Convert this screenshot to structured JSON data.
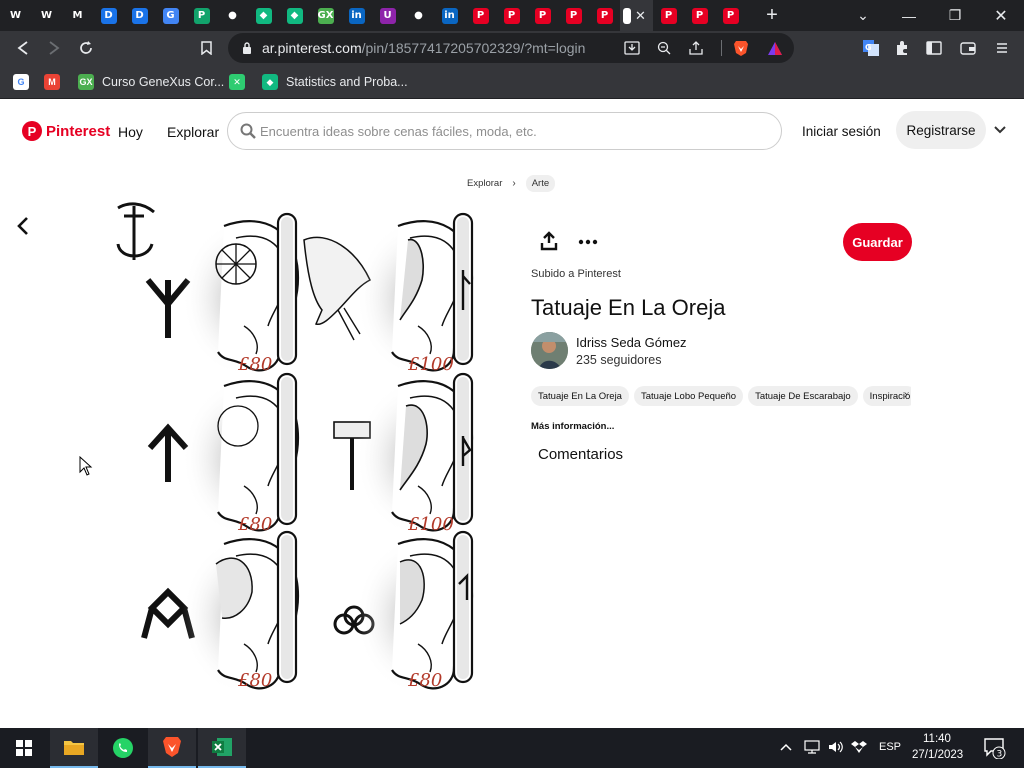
{
  "browser": {
    "tabs": [
      {
        "icon": "wix-icon",
        "label": "",
        "color": "#202124",
        "text": "W"
      },
      {
        "icon": "webflow-icon",
        "label": "",
        "color": "#202124",
        "text": "W"
      },
      {
        "icon": "gmail-icon",
        "label": "",
        "color": "#202124",
        "text": "M"
      },
      {
        "icon": "blue-circle-icon",
        "label": "",
        "color": "#1a73e8",
        "text": "D"
      },
      {
        "icon": "blue-circle-icon",
        "label": "",
        "color": "#1a73e8",
        "text": "D"
      },
      {
        "icon": "translate-icon",
        "label": "",
        "color": "#4285f4",
        "text": "G"
      },
      {
        "icon": "green-circle-icon",
        "label": "",
        "color": "#12a36c",
        "text": "P"
      },
      {
        "icon": "github-icon",
        "label": "",
        "color": "#202124",
        "text": "●"
      },
      {
        "icon": "gem-icon",
        "label": "",
        "color": "#11b981",
        "text": "◆"
      },
      {
        "icon": "gem-icon",
        "label": "",
        "color": "#11b981",
        "text": "◆"
      },
      {
        "icon": "genexus-icon",
        "label": "",
        "color": "#4caf50",
        "text": "GX"
      },
      {
        "icon": "linkedin-icon",
        "label": "",
        "color": "#0a66c2",
        "text": "in"
      },
      {
        "icon": "purple-icon",
        "label": "",
        "color": "#8e24aa",
        "text": "U"
      },
      {
        "icon": "github-icon",
        "label": "",
        "color": "#202124",
        "text": "●"
      },
      {
        "icon": "linkedin-icon",
        "label": "",
        "color": "#0a66c2",
        "text": "in"
      },
      {
        "icon": "pinterest-icon",
        "label": "",
        "color": "#e60023",
        "text": "P"
      },
      {
        "icon": "pinterest-icon",
        "label": "",
        "color": "#e60023",
        "text": "P"
      },
      {
        "icon": "pinterest-icon",
        "label": "",
        "color": "#e60023",
        "text": "P"
      },
      {
        "icon": "pinterest-icon",
        "label": "",
        "color": "#e60023",
        "text": "P"
      },
      {
        "icon": "pinterest-icon",
        "label": "",
        "color": "#e60023",
        "text": "P"
      }
    ],
    "tabs_after": [
      {
        "icon": "pinterest-icon",
        "color": "#e60023",
        "text": "P"
      },
      {
        "icon": "pinterest-icon",
        "color": "#e60023",
        "text": "P"
      },
      {
        "icon": "pinterest-icon",
        "color": "#e60023",
        "text": "P"
      }
    ],
    "url_host": "ar.pinterest.com",
    "url_path": "/pin/18577417205702329/?mt=login"
  },
  "bookmarks": [
    {
      "icon": "google-icon",
      "label": "",
      "color": "#ffffff",
      "text": "G"
    },
    {
      "icon": "gmail-icon",
      "label": "",
      "color": "#ea4335",
      "text": "M"
    },
    {
      "icon": "genexus-icon",
      "label": "Curso GeneXus Cor...",
      "color": "#4caf50",
      "text": "GX"
    },
    {
      "icon": "x-icon",
      "label": "",
      "color": "#2ecc71",
      "text": "✕"
    },
    {
      "icon": "gem-icon",
      "label": "Statistics and Proba...",
      "color": "#11b981",
      "text": "◆"
    }
  ],
  "header": {
    "logo": "Pinterest",
    "nav_today": "Hoy",
    "nav_explore": "Explorar",
    "search_placeholder": "Encuentra ideas sobre cenas fáciles, moda, etc.",
    "login": "Iniciar sesión",
    "register": "Registrarse"
  },
  "breadcrumb": {
    "root": "Explorar",
    "current": "Arte"
  },
  "pin": {
    "save": "Guardar",
    "uploaded_to": "Subido a Pinterest",
    "title": "Tatuaje En La Oreja",
    "author": "Idriss Seda Gómez",
    "followers": "235 seguidores",
    "tags": [
      "Tatuaje En La Oreja",
      "Tatuaje Lobo Pequeño",
      "Tatuaje De Escarabajo",
      "Inspiració"
    ],
    "more_info": "Más información...",
    "comments": "Comentarios",
    "prices": [
      "£80",
      "£100",
      "£80",
      "£100",
      "£80",
      "£80"
    ]
  },
  "taskbar": {
    "lang": "ESP",
    "time": "11:40",
    "date": "27/1/2023",
    "notifications": "3"
  },
  "colors": {
    "brand": "#e60023",
    "chrome_dark": "#202124",
    "chrome": "#35363a"
  }
}
